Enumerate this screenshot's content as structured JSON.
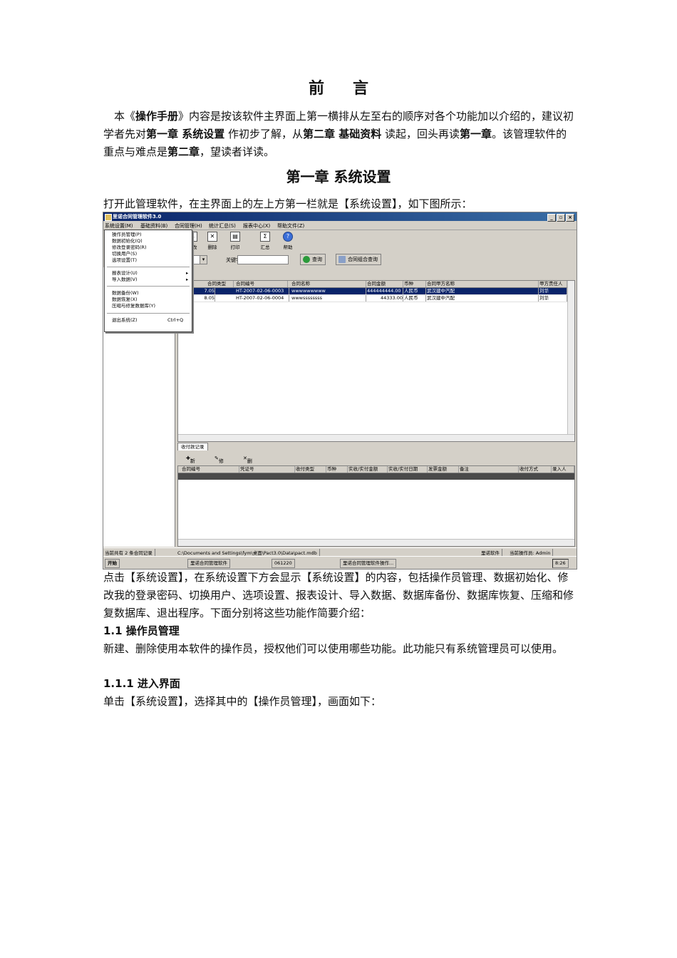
{
  "preface_title": [
    "前",
    "言"
  ],
  "intro": {
    "p1": "本《",
    "p2": "操作手册",
    "p3": "》内容是按该软件主界面上第一横排从左至右的顺序对各个功能加以介绍的，建议初学者先对",
    "p4": "第一章 系统设置",
    "p5": " 作初步了解，从",
    "p6": "第二章 基础资料",
    "p7": " 读起，回头再读",
    "p8": "第一章",
    "p9": "。该管理软件的重点与难点是",
    "p10": "第二章",
    "p11": "，望读者详读。"
  },
  "chapter1_title": "第一章 系统设置",
  "open_text": "打开此管理软件，在主界面上的左上方第一栏就是【系统设置】，如下图所示：",
  "screenshot": {
    "window_title": "里诺合同管理软件3.0",
    "win_buttons": [
      "_",
      "▫",
      "×"
    ],
    "menu": [
      "系统设置(M)",
      "基础资料(B)",
      "合同管理(H)",
      "统计汇总(S)",
      "报表中心(X)",
      "帮助文件(Z)"
    ],
    "toolbar": [
      {
        "label": "修改",
        "icon": "edit-icon"
      },
      {
        "label": "删除",
        "icon": "delete-icon"
      },
      {
        "label": "打印",
        "icon": "print-icon"
      },
      {
        "label": "汇总",
        "icon": "summary-icon"
      },
      {
        "label": "帮助",
        "icon": "help-icon"
      }
    ],
    "keyword_label": "关键字",
    "query_btn": "查询",
    "combo_query_btn": "合同组合查询",
    "dropdown": [
      "操作员管理(P)",
      "数据初始化(Q)",
      "修改登录密码(R)",
      "切换用户(S)",
      "选项设置(T)",
      "报表设计(U)",
      "导入数据(V)",
      "数据备份(W)",
      "数据恢复(X)",
      "压缩与修复数据库(Y)",
      "退出系统(Z)"
    ],
    "exit_shortcut": "Ctrl+Q",
    "grid_headers": [
      "",
      "合同类型",
      "合同编号",
      "合同名称",
      "合同金额",
      "币种",
      "合同甲方名称",
      "甲方责任人"
    ],
    "grid_rows": [
      [
        "7.05",
        "",
        "HT-2007-02-06-0003",
        "wwwwwwwww",
        "444444444.00",
        "人民币",
        "武汉建中汽配",
        "刘华"
      ],
      [
        "8.05",
        "",
        "HT-2007-02-06-0004",
        "wwwssssssss",
        "44333.00",
        "人民币",
        "武汉建中汽配",
        "刘华"
      ]
    ],
    "tab_label": "收付款记录",
    "subtool": [
      "新增",
      "修改",
      "删除"
    ],
    "grid2_headers": [
      "合同编号",
      "凭证号",
      "收付类型",
      "币种",
      "实收/实付金额",
      "实收/实付日期",
      "发票金额",
      "备注",
      "收付方式",
      "录入人"
    ],
    "status": [
      "当前共有 2 条合同记录",
      "C:\\Documents and Settings\\fym\\桌面\\Pact3.0\\Data\\pact.mdb",
      "里诺软件",
      "当前操作员: Admin"
    ],
    "taskbar": [
      "开始",
      "里诺合同管理软件",
      "061220",
      "里诺合同管理软件操作..."
    ],
    "clock": "8:26"
  },
  "after_text": "点击【系统设置】，在系统设置下方会显示【系统设置】的内容，包括操作员管理、数据初始化、修改我的登录密码、切换用户、选项设置、报表设计、导入数据、数据库备份、数据库恢复、压缩和修复数据库、退出程序。下面分别将这些功能作简要介绍：",
  "sec_1_1": "1.1 操作员管理",
  "sec_1_1_text": "新建、删除使用本软件的操作员，授权他们可以使用哪些功能。此功能只有系统管理员可以使用。",
  "sec_1_1_1": "1.1.1 进入界面",
  "sec_1_1_1_text": "单击【系统设置】，选择其中的【操作员管理】，画面如下："
}
